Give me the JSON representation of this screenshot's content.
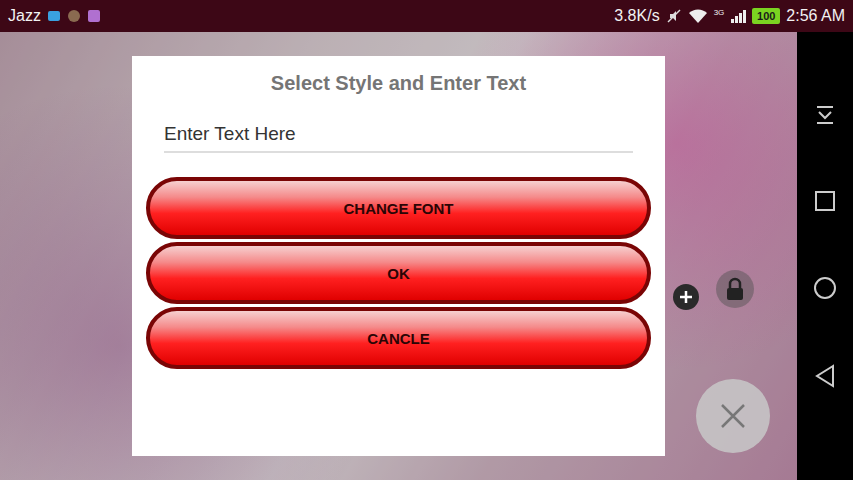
{
  "status_bar": {
    "carrier": "Jazz",
    "speed": "3.8K/s",
    "network": "3G",
    "battery": "100",
    "time": "2:56 AM"
  },
  "dialog": {
    "title": "Select Style and Enter Text",
    "input": {
      "placeholder": "Enter Text Here",
      "value": "",
      "focused": true
    },
    "buttons": [
      "CHANGE FONT",
      "OK",
      "CANCLE"
    ]
  }
}
